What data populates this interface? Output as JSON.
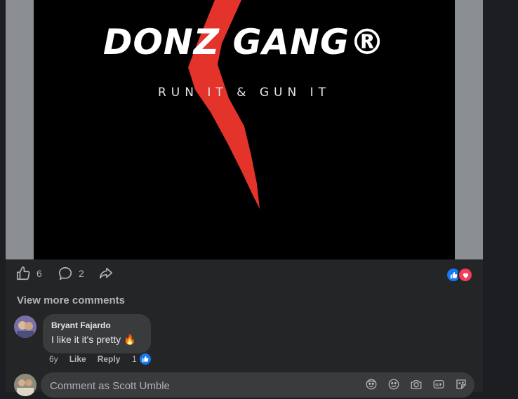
{
  "post": {
    "image": {
      "logo_title": "DONZ GANG®",
      "logo_tagline": "RUN IT & GUN IT",
      "bolt_color": "#e3332b"
    },
    "actions": {
      "like_count": "6",
      "comment_count": "2",
      "like_icon": "thumbs-up-icon",
      "comment_icon": "comment-bubble-icon",
      "share_icon": "share-arrow-icon"
    },
    "reaction_icons": [
      "like-reaction-icon",
      "love-reaction-icon"
    ],
    "colors": {
      "like_blue": "#1877f2",
      "love_red": "#f33e58"
    }
  },
  "comments": {
    "view_more_label": "View more comments",
    "items": [
      {
        "author": "Bryant Fajardo",
        "text": "I like it it's pretty 🔥",
        "age": "6y",
        "like_label": "Like",
        "reply_label": "Reply",
        "reaction_count": "1"
      }
    ]
  },
  "composer": {
    "placeholder": "Comment as Scott Umble",
    "icons": [
      "avatar-sticker-icon",
      "emoji-icon",
      "camera-icon",
      "gif-icon",
      "sticker-icon"
    ]
  }
}
